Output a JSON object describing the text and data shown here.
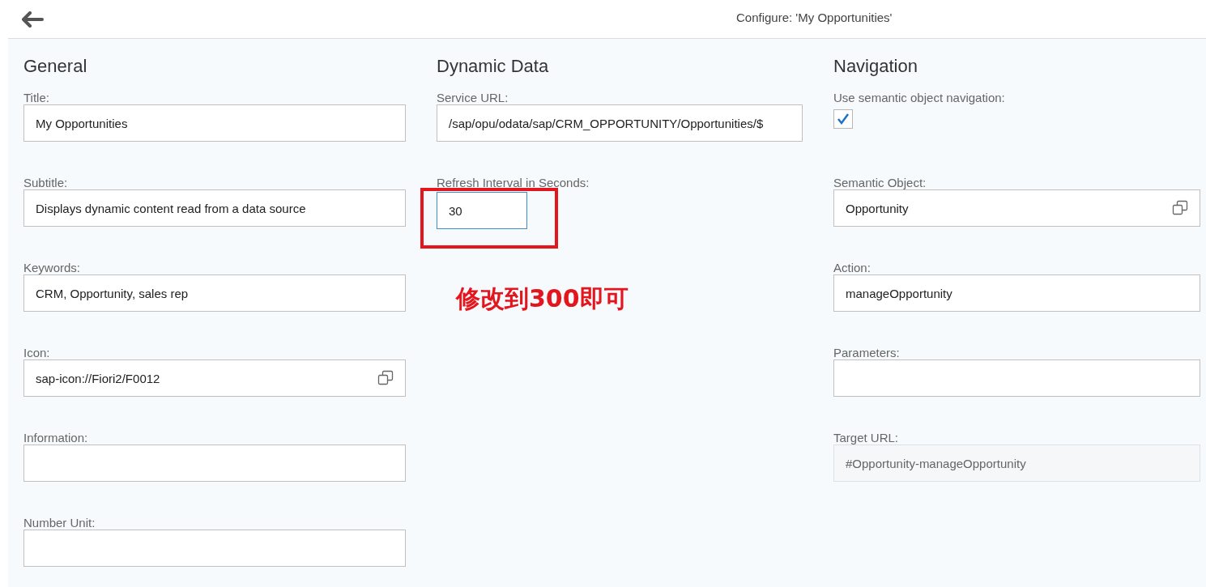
{
  "header": {
    "title": "Configure: 'My Opportunities'"
  },
  "columns": [
    {
      "heading": "General",
      "fields": [
        {
          "kind": "text",
          "label": "Title:",
          "value": "My Opportunities",
          "value_help": false,
          "focused": false,
          "disabled": false
        },
        {
          "kind": "text",
          "label": "Subtitle:",
          "value": "Displays dynamic content read from a data source",
          "value_help": false,
          "focused": false,
          "disabled": false
        },
        {
          "kind": "text",
          "label": "Keywords:",
          "value": "CRM, Opportunity, sales rep",
          "value_help": false,
          "focused": false,
          "disabled": false
        },
        {
          "kind": "text",
          "label": "Icon:",
          "value": "sap-icon://Fiori2/F0012",
          "value_help": true,
          "focused": false,
          "disabled": false
        },
        {
          "kind": "text",
          "label": "Information:",
          "value_help": false,
          "focused": false,
          "disabled": false
        },
        {
          "kind": "text",
          "label": "Number Unit:",
          "value_help": false,
          "focused": false,
          "disabled": false
        }
      ]
    },
    {
      "heading": "Dynamic Data",
      "fields": [
        {
          "kind": "text",
          "label": "Service URL:",
          "value": "/sap/opu/odata/sap/CRM_OPPORTUNITY/Opportunities/$",
          "value_help": false,
          "focused": false,
          "disabled": false
        },
        {
          "kind": "short",
          "label": "Refresh Interval in Seconds:",
          "value": "30",
          "value_help": false,
          "focused": true,
          "disabled": false,
          "highlighted": true
        }
      ]
    },
    {
      "heading": "Navigation",
      "fields": [
        {
          "kind": "checkbox",
          "label": "Use semantic object navigation:",
          "checked": true
        },
        {
          "kind": "text",
          "label": "Semantic Object:",
          "value": "Opportunity",
          "value_help": true,
          "focused": false,
          "disabled": false
        },
        {
          "kind": "text",
          "label": "Action:",
          "value": "manageOpportunity",
          "value_help": false,
          "focused": false,
          "disabled": false
        },
        {
          "kind": "text",
          "label": "Parameters:",
          "value_help": false,
          "focused": false,
          "disabled": false
        },
        {
          "kind": "text",
          "label": "Target URL:",
          "value": "#Opportunity-manageOpportunity",
          "value_help": false,
          "focused": false,
          "disabled": true
        }
      ]
    }
  ],
  "annotation": {
    "note": "修改到300即可"
  }
}
